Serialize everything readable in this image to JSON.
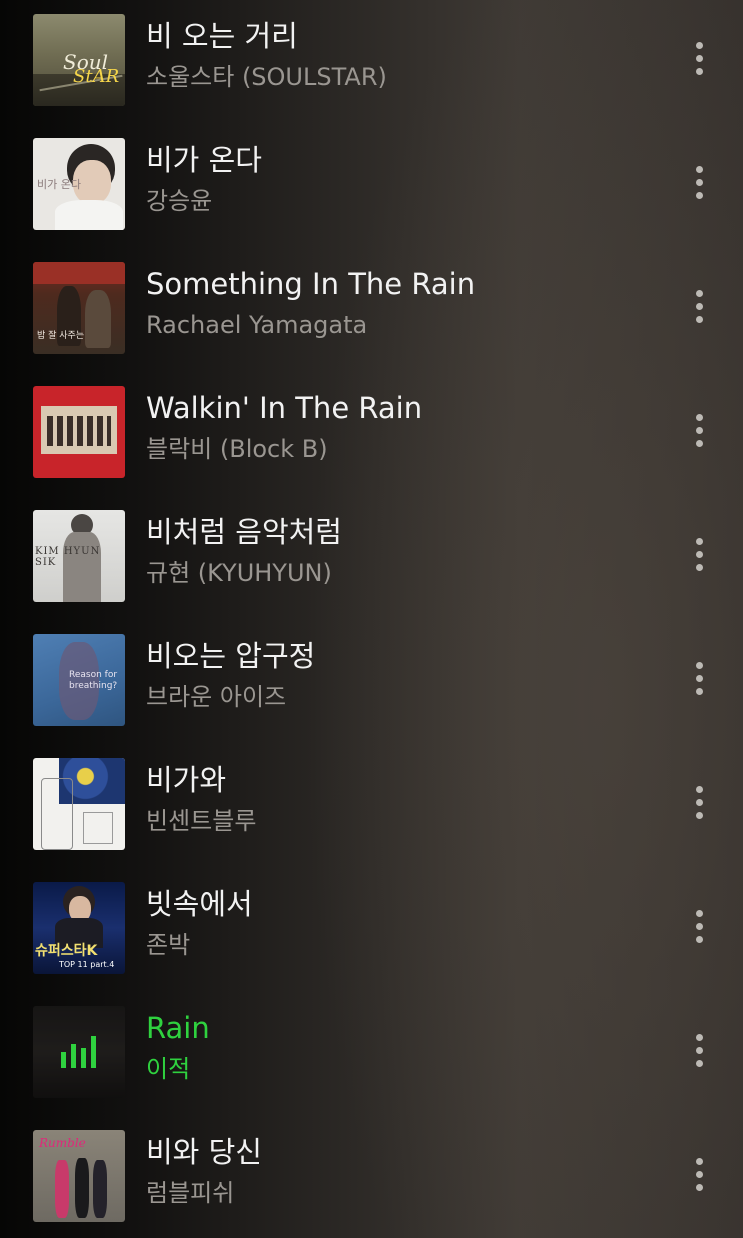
{
  "accent_color": "#2fd23f",
  "songs": [
    {
      "title": "비 오는 거리",
      "artist": "소울스타 (SOULSTAR)",
      "playing": false,
      "art_text": "Soul StAR 비오는거리"
    },
    {
      "title": "비가 온다",
      "artist": "강승윤",
      "playing": false,
      "art_text": "비가 온다"
    },
    {
      "title": "Something In The Rain",
      "artist": "Rachael Yamagata",
      "playing": false,
      "art_text": "밥 잘 사주는 예쁜 누나"
    },
    {
      "title": "Walkin' In The Rain",
      "artist": "블락비 (Block B)",
      "playing": false,
      "art_text": ""
    },
    {
      "title": "비처럼 음악처럼",
      "artist": "규현 (KYUHYUN)",
      "playing": false,
      "art_text": "KIM HYUN SIK"
    },
    {
      "title": "비오는 압구정",
      "artist": "브라운 아이즈",
      "playing": false,
      "art_text": "Reason for breathing?"
    },
    {
      "title": "비가와",
      "artist": "빈센트블루",
      "playing": false,
      "art_text": ""
    },
    {
      "title": "빗속에서",
      "artist": "존박",
      "playing": false,
      "art_text": "슈퍼스타K TOP 11 part.4"
    },
    {
      "title": "Rain",
      "artist": "이적",
      "playing": true,
      "art_text": ""
    },
    {
      "title": "비와 당신",
      "artist": "럼블피쉬",
      "playing": false,
      "art_text": ""
    }
  ]
}
